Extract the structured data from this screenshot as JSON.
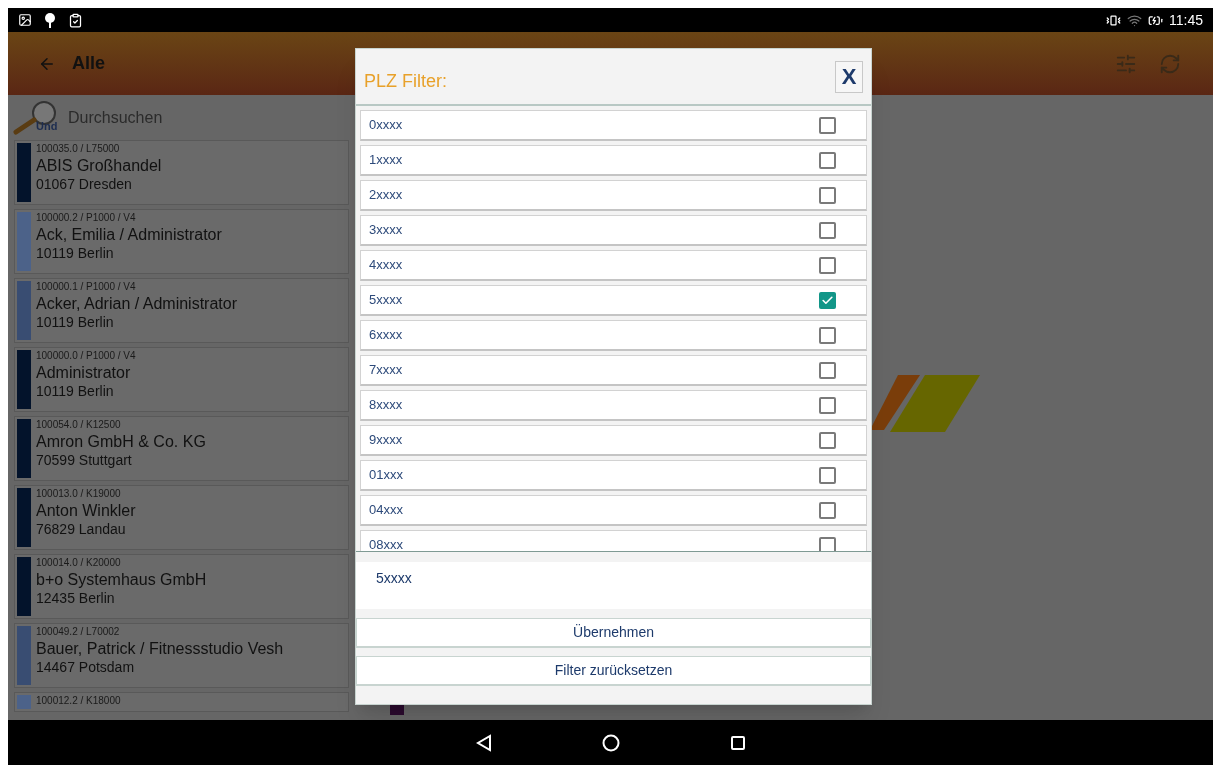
{
  "status_bar": {
    "time": "11:45"
  },
  "toolbar": {
    "title": "Alle"
  },
  "search": {
    "badge": "Und",
    "placeholder": "Durchsuchen"
  },
  "contacts": [
    {
      "code": "100035.0 / L75000",
      "name": "ABIS Großhandel",
      "city": "01067 Dresden",
      "color": "#03132b"
    },
    {
      "code": "100000.2 / P1000 / V4",
      "name": "Ack, Emilia / Administrator",
      "city": "10119 Berlin",
      "color": "#4c6289"
    },
    {
      "code": "100000.1 / P1000 / V4",
      "name": "Acker, Adrian / Administrator",
      "city": "10119 Berlin",
      "color": "#394d72"
    },
    {
      "code": "100000.0 / P1000 / V4",
      "name": "Administrator",
      "city": "10119 Berlin",
      "color": "#03132b"
    },
    {
      "code": "100054.0 / K12500",
      "name": "Amron GmbH & Co. KG",
      "city": "70599 Stuttgart",
      "color": "#03132b"
    },
    {
      "code": "100013.0 / K19000",
      "name": "Anton Winkler",
      "city": "76829 Landau",
      "color": "#03132b"
    },
    {
      "code": "100014.0 / K20000",
      "name": "b+o Systemhaus GmbH",
      "city": "12435 Berlin",
      "color": "#03132b"
    },
    {
      "code": "100049.2 / L70002",
      "name": "Bauer, Patrick / Fitnessstudio Vesh",
      "city": "14467 Potsdam",
      "color": "#394d72"
    },
    {
      "code": "100012.2 / K18000",
      "color": "#4c6289"
    }
  ],
  "dialog": {
    "title": "PLZ Filter:",
    "close": "X",
    "options": [
      {
        "label": "0xxxx",
        "checked": false
      },
      {
        "label": "1xxxx",
        "checked": false
      },
      {
        "label": "2xxxx",
        "checked": false
      },
      {
        "label": "3xxxx",
        "checked": false
      },
      {
        "label": "4xxxx",
        "checked": false
      },
      {
        "label": "5xxxx",
        "checked": true
      },
      {
        "label": "6xxxx",
        "checked": false
      },
      {
        "label": "7xxxx",
        "checked": false
      },
      {
        "label": "8xxxx",
        "checked": false
      },
      {
        "label": "9xxxx",
        "checked": false
      },
      {
        "label": "01xxx",
        "checked": false
      },
      {
        "label": "04xxx",
        "checked": false
      },
      {
        "label": "08xxx",
        "checked": false
      }
    ],
    "selection": "5xxxx",
    "buttons": [
      "Übernehmen",
      "Filter zurücksetzen"
    ]
  }
}
